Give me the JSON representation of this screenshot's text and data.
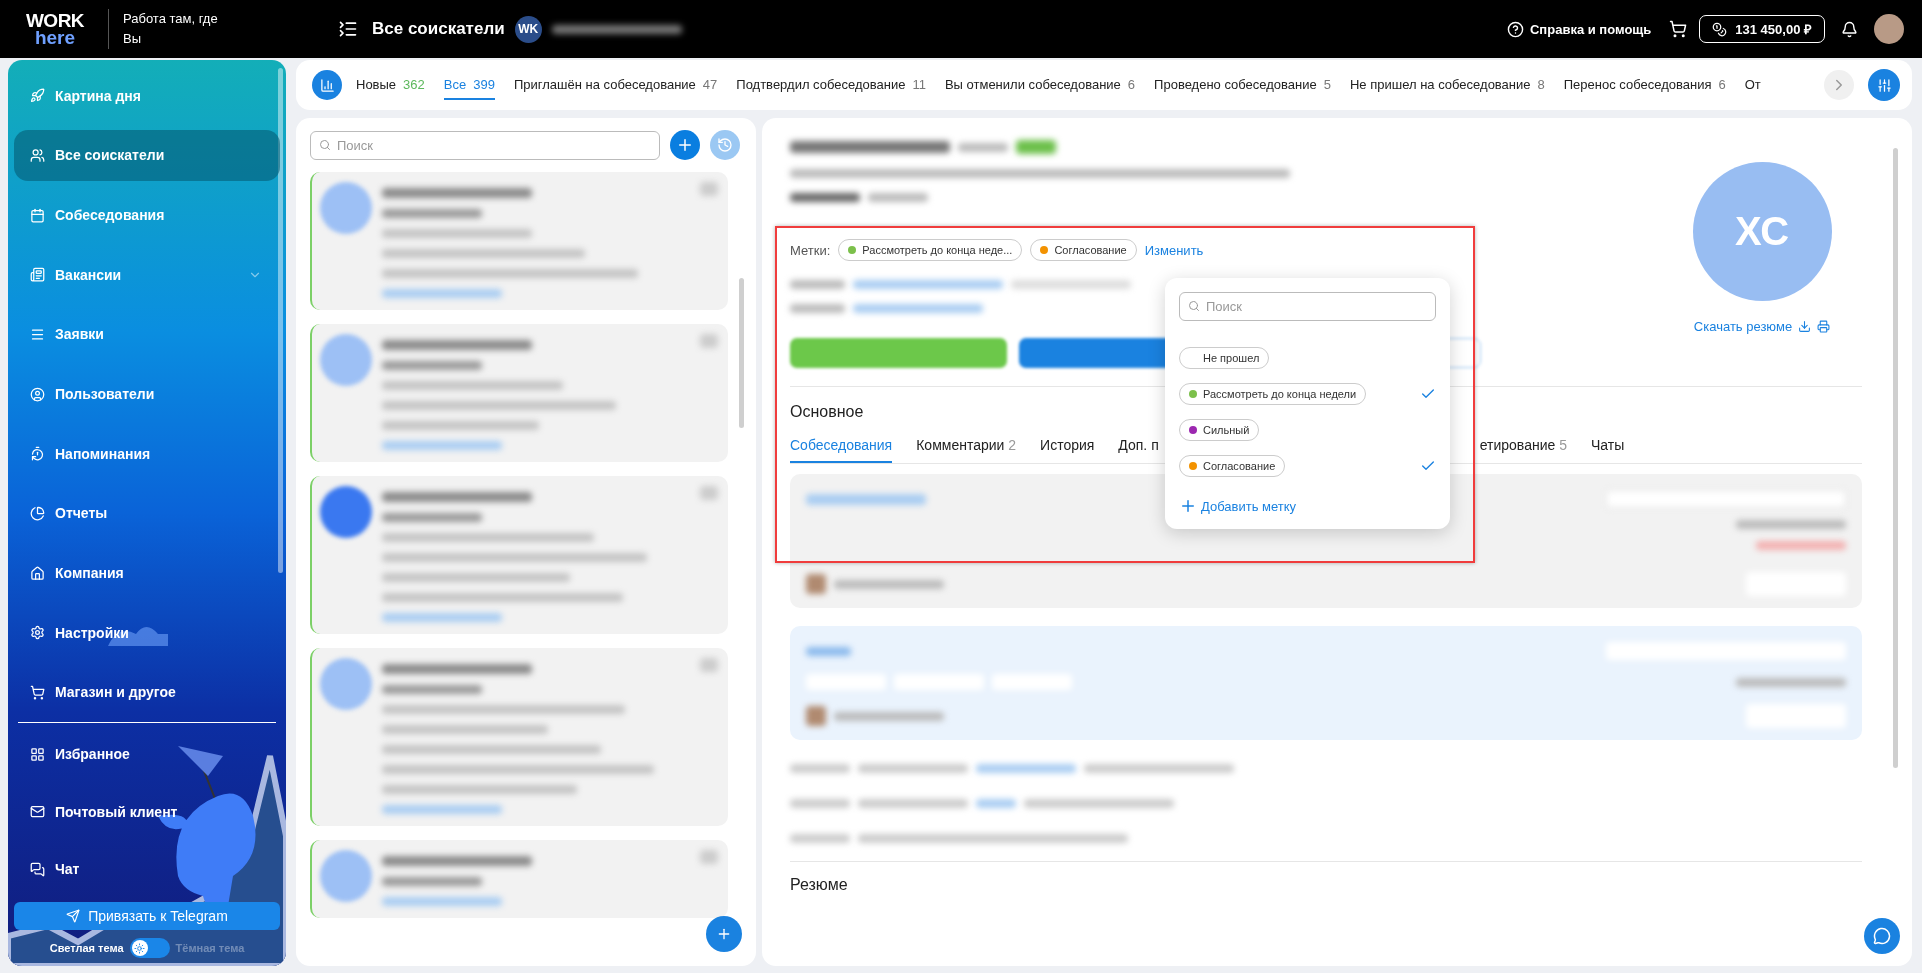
{
  "header": {
    "logo_top": "WORK",
    "logo_bottom": "here",
    "tagline": "Работа там, где Вы",
    "title": "Все соискатели",
    "company_initials": "WK",
    "help": "Справка и помощь",
    "balance": "131 450,00 ₽"
  },
  "sidebar": {
    "items": [
      {
        "label": "Картина дня",
        "selected": false
      },
      {
        "label": "Все соискатели",
        "selected": true
      },
      {
        "label": "Собеседования",
        "selected": false
      },
      {
        "label": "Вакансии",
        "selected": false,
        "has_submenu": true
      },
      {
        "label": "Заявки",
        "selected": false
      },
      {
        "label": "Пользователи",
        "selected": false
      },
      {
        "label": "Напоминания",
        "selected": false
      },
      {
        "label": "Отчеты",
        "selected": false
      },
      {
        "label": "Компания",
        "selected": false
      },
      {
        "label": "Настройки",
        "selected": false
      },
      {
        "label": "Магазин и другое",
        "selected": false
      }
    ],
    "bottom_items": [
      {
        "label": "Избранное",
        "selected": false
      },
      {
        "label": "Почтовый клиент",
        "selected": false
      },
      {
        "label": "Чат",
        "selected": false
      }
    ],
    "telegram_button": "Привязать к Telegram",
    "theme": {
      "light_label": "Светлая тема",
      "dark_label": "Тёмная тема",
      "dark": false
    }
  },
  "filter_tabs": [
    {
      "label": "Новые",
      "count": "362",
      "selected": false,
      "color": "#5cb85c"
    },
    {
      "label": "Все",
      "count": "399",
      "selected": true,
      "color": "#1a82e0"
    },
    {
      "label": "Приглашён на собеседование",
      "count": "47",
      "selected": false,
      "color": "#777777"
    },
    {
      "label": "Подтвердил собеседование",
      "count": "11",
      "selected": false,
      "color": "#777777"
    },
    {
      "label": "Вы отменили собеседование",
      "count": "6",
      "selected": false,
      "color": "#777777"
    },
    {
      "label": "Проведено собеседование",
      "count": "5",
      "selected": false,
      "color": "#777777"
    },
    {
      "label": "Не пришел на собеседование",
      "count": "8",
      "selected": false,
      "color": "#777777"
    },
    {
      "label": "Перенос собеседования",
      "count": "6",
      "selected": false,
      "color": "#777777"
    },
    {
      "label": "От",
      "selected": false
    }
  ],
  "list": {
    "search_placeholder": "Поиск"
  },
  "candidate": {
    "initials": "ХС",
    "tags_label": "Метки:",
    "tags": [
      {
        "label": "Рассмотреть до конца неде...",
        "color": "#7cc04b"
      },
      {
        "label": "Согласование",
        "color": "#f39200"
      }
    ],
    "edit_link": "Изменить",
    "download": "Скачать резюме",
    "section_title": "Основное",
    "tabs": [
      {
        "label": "Собеседования",
        "selected": true,
        "kind": "full"
      },
      {
        "label": "Комментарии",
        "count": "2",
        "selected": false,
        "kind": "full"
      },
      {
        "label": "История",
        "selected": false,
        "kind": "full"
      },
      {
        "label": "Доп. п",
        "selected": false,
        "kind": "cut_right"
      },
      {
        "label": "етирование",
        "count": "5",
        "selected": false,
        "kind": "cut_left"
      },
      {
        "label": "Чаты",
        "selected": false,
        "kind": "full"
      }
    ],
    "resume_title": "Резюме"
  },
  "tag_dropdown": {
    "placeholder": "Поиск",
    "options": [
      {
        "label": "Не прошел",
        "selected": false
      },
      {
        "label": "Рассмотреть до конца недели",
        "color": "#7cc04b",
        "selected": true
      },
      {
        "label": "Сильный",
        "color": "#9c27b0",
        "selected": false
      },
      {
        "label": "Согласование",
        "color": "#f39200",
        "selected": true
      }
    ],
    "add_label": "Добавить метку"
  }
}
